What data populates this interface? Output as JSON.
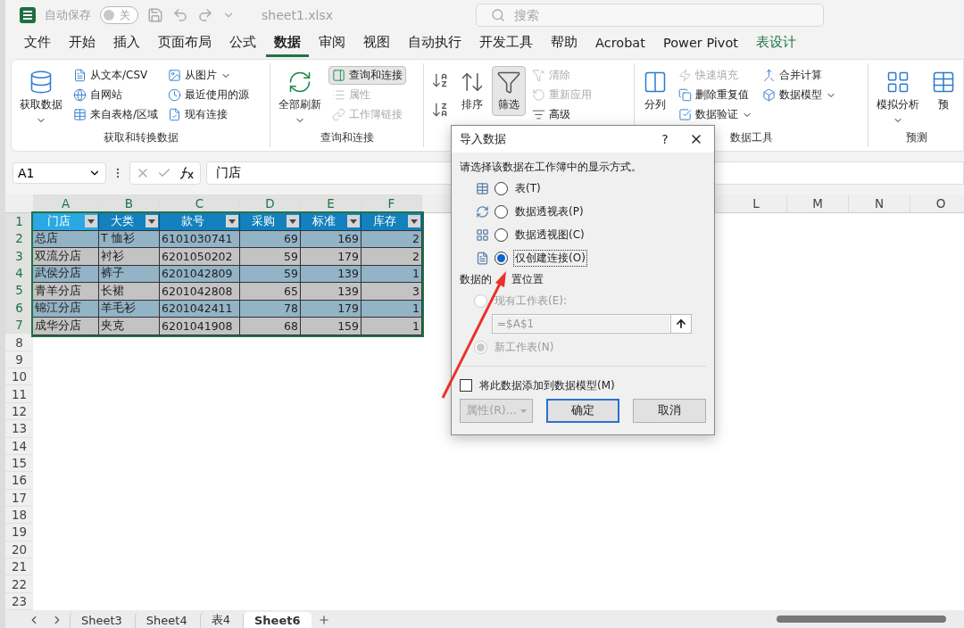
{
  "title_bar": {
    "autosave_label": "自动保存",
    "autosave_toggle": {
      "on": false,
      "label": "关"
    },
    "file_name": "sheet1.xlsx",
    "search": {
      "placeholder": "搜索"
    }
  },
  "menu_tabs": [
    {
      "label": "文件",
      "selected": false,
      "kind": "normal"
    },
    {
      "label": "开始",
      "selected": false,
      "kind": "normal"
    },
    {
      "label": "插入",
      "selected": false,
      "kind": "normal"
    },
    {
      "label": "页面布局",
      "selected": false,
      "kind": "normal"
    },
    {
      "label": "公式",
      "selected": false,
      "kind": "normal"
    },
    {
      "label": "数据",
      "selected": true,
      "kind": "normal"
    },
    {
      "label": "审阅",
      "selected": false,
      "kind": "normal"
    },
    {
      "label": "视图",
      "selected": false,
      "kind": "normal"
    },
    {
      "label": "自动执行",
      "selected": false,
      "kind": "normal"
    },
    {
      "label": "开发工具",
      "selected": false,
      "kind": "normal"
    },
    {
      "label": "帮助",
      "selected": false,
      "kind": "normal"
    },
    {
      "label": "Acrobat",
      "selected": false,
      "kind": "normal"
    },
    {
      "label": "Power Pivot",
      "selected": false,
      "kind": "normal"
    },
    {
      "label": "表设计",
      "selected": false,
      "kind": "contextual"
    }
  ],
  "ribbon_groups": [
    {
      "label": "获取和转换数据",
      "columns": [
        [
          {
            "kind": "large",
            "label": "获取数据",
            "dropdown": true,
            "disabled": false,
            "pressed": false
          }
        ],
        [
          {
            "kind": "small",
            "label": "从文本/CSV",
            "dropdown": false,
            "disabled": false,
            "pressed": false
          },
          {
            "kind": "small",
            "label": "自网站",
            "dropdown": false,
            "disabled": false,
            "pressed": false
          },
          {
            "kind": "small",
            "label": "来自表格/区域",
            "dropdown": false,
            "disabled": false,
            "pressed": false
          }
        ],
        [
          {
            "kind": "small",
            "label": "从图片",
            "dropdown": true,
            "disabled": false,
            "pressed": false
          },
          {
            "kind": "small",
            "label": "最近使用的源",
            "dropdown": false,
            "disabled": false,
            "pressed": false
          },
          {
            "kind": "small",
            "label": "现有连接",
            "dropdown": false,
            "disabled": false,
            "pressed": false
          }
        ]
      ]
    },
    {
      "label": "查询和连接",
      "columns": [
        [
          {
            "kind": "large",
            "label": "全部刷新",
            "dropdown": true,
            "disabled": false,
            "pressed": false
          }
        ],
        [
          {
            "kind": "small",
            "label": "查询和连接",
            "dropdown": false,
            "disabled": false,
            "pressed": true
          },
          {
            "kind": "small",
            "label": "属性",
            "dropdown": false,
            "disabled": true,
            "pressed": false
          },
          {
            "kind": "small",
            "label": "工作簿链接",
            "dropdown": false,
            "disabled": true,
            "pressed": false
          }
        ]
      ]
    },
    {
      "columns": [
        [
          {
            "kind": "icon",
            "dropdown": false,
            "disabled": false,
            "pressed": false
          },
          {
            "kind": "icon",
            "dropdown": false,
            "disabled": false,
            "pressed": false
          }
        ],
        [
          {
            "kind": "large",
            "label": "排序",
            "dropdown": false,
            "disabled": false,
            "pressed": false
          }
        ],
        [
          {
            "kind": "large",
            "label": "筛选",
            "dropdown": false,
            "disabled": false,
            "pressed": true
          }
        ],
        [
          {
            "kind": "small",
            "label": "清除",
            "dropdown": false,
            "disabled": true,
            "pressed": false
          },
          {
            "kind": "small",
            "label": "重新应用",
            "dropdown": false,
            "disabled": true,
            "pressed": false
          },
          {
            "kind": "small",
            "label": "高级",
            "dropdown": false,
            "disabled": false,
            "pressed": false
          }
        ]
      ]
    },
    {
      "label": "数据工具",
      "columns": [
        [
          {
            "kind": "large",
            "label": "分列",
            "dropdown": false,
            "disabled": false,
            "pressed": false
          }
        ],
        [
          {
            "kind": "small",
            "label": "快速填充",
            "dropdown": false,
            "disabled": true,
            "pressed": false
          },
          {
            "kind": "small",
            "label": "删除重复值",
            "dropdown": false,
            "disabled": false,
            "pressed": false
          },
          {
            "kind": "small",
            "label": "数据验证",
            "dropdown": true,
            "disabled": false,
            "pressed": false
          }
        ],
        [
          {
            "kind": "small",
            "label": "合并计算",
            "dropdown": false,
            "disabled": false,
            "pressed": false
          },
          {
            "kind": "small",
            "label": "数据模型",
            "dropdown": true,
            "disabled": false,
            "pressed": false
          }
        ]
      ]
    },
    {
      "label": "预测",
      "columns": [
        [
          {
            "kind": "large",
            "label": "模拟分析",
            "dropdown": true,
            "disabled": false,
            "pressed": false
          }
        ],
        [
          {
            "kind": "large",
            "label": "预",
            "dropdown": false,
            "disabled": false,
            "pressed": false
          }
        ]
      ]
    }
  ],
  "formula_bar": {
    "name_box": "A1",
    "formula": "门店"
  },
  "columns_left": [
    {
      "label": "A",
      "selected": true
    },
    {
      "label": "B",
      "selected": true
    },
    {
      "label": "C",
      "selected": true
    },
    {
      "label": "D",
      "selected": true
    },
    {
      "label": "E",
      "selected": true
    },
    {
      "label": "F",
      "selected": true
    }
  ],
  "columns_right": [
    {
      "label": "L",
      "selected": false
    },
    {
      "label": "M",
      "selected": false
    },
    {
      "label": "N",
      "selected": false
    },
    {
      "label": "O",
      "selected": false
    }
  ],
  "row_numbers": [
    {
      "label": "1",
      "selected": true
    },
    {
      "label": "2",
      "selected": true
    },
    {
      "label": "3",
      "selected": true
    },
    {
      "label": "4",
      "selected": true
    },
    {
      "label": "5",
      "selected": true
    },
    {
      "label": "6",
      "selected": true
    },
    {
      "label": "7",
      "selected": true
    },
    {
      "label": "8",
      "selected": false
    },
    {
      "label": "9",
      "selected": false
    },
    {
      "label": "10",
      "selected": false
    },
    {
      "label": "11",
      "selected": false
    },
    {
      "label": "12",
      "selected": false
    },
    {
      "label": "13",
      "selected": false
    },
    {
      "label": "14",
      "selected": false
    },
    {
      "label": "15",
      "selected": false
    },
    {
      "label": "16",
      "selected": false
    },
    {
      "label": "17",
      "selected": false
    },
    {
      "label": "18",
      "selected": false
    },
    {
      "label": "19",
      "selected": false
    },
    {
      "label": "20",
      "selected": false
    },
    {
      "label": "21",
      "selected": false
    },
    {
      "label": "22",
      "selected": false
    },
    {
      "label": "23",
      "selected": false
    }
  ],
  "table": {
    "headers": [
      {
        "label": "门店",
        "selected": true
      },
      {
        "label": "大类",
        "selected": false
      },
      {
        "label": "款号",
        "selected": false
      },
      {
        "label": "采购",
        "selected": false
      },
      {
        "label": "标准",
        "selected": false
      },
      {
        "label": "库存",
        "selected": false
      }
    ],
    "rows": [
      [
        "总店",
        "T 恤衫",
        "6101030741",
        "69",
        "169",
        "2"
      ],
      [
        "双流分店",
        "衬衫",
        "6201050202",
        "59",
        "179",
        "2"
      ],
      [
        "武侯分店",
        "裤子",
        "6201042809",
        "59",
        "139",
        "1"
      ],
      [
        "青羊分店",
        "长裙",
        "6201042808",
        "65",
        "139",
        "3"
      ],
      [
        "锦江分店",
        "羊毛衫",
        "6201042411",
        "78",
        "179",
        "1"
      ],
      [
        "成华分店",
        "夹克",
        "6201041908",
        "68",
        "159",
        "1"
      ]
    ]
  },
  "dialog": {
    "title": "导入数据",
    "help": "?",
    "prompt": "请选择该数据在工作簿中的显示方式。",
    "view_options": [
      {
        "label": "表(T)",
        "selected": false
      },
      {
        "label": "数据透视表(P)",
        "selected": false
      },
      {
        "label": "数据透视图(C)",
        "selected": false
      },
      {
        "label": "仅创建连接(O)",
        "selected": true
      }
    ],
    "placement_label": [
      "数据的",
      "置位置"
    ],
    "placement_options": [
      {
        "label": "现有工作表(E):",
        "selected": false,
        "disabled": true
      },
      {
        "label": "新工作表(N)",
        "selected": true,
        "disabled": true
      }
    ],
    "location_field": {
      "value": "=$A$1",
      "disabled": true
    },
    "add_to_model": {
      "label": "将此数据添加到数据模型(M)",
      "checked": false
    },
    "buttons": [
      {
        "label": "属性(R)...",
        "disabled": true,
        "dropdown": true,
        "default": false
      },
      {
        "label": "确定",
        "disabled": false,
        "dropdown": false,
        "default": true
      },
      {
        "label": "取消",
        "disabled": false,
        "dropdown": false,
        "default": false
      }
    ]
  },
  "sheet_tabs": [
    {
      "label": "Sheet3",
      "selected": false
    },
    {
      "label": "Sheet4",
      "selected": false
    },
    {
      "label": "表4",
      "selected": false
    },
    {
      "label": "Sheet6",
      "selected": true
    }
  ]
}
